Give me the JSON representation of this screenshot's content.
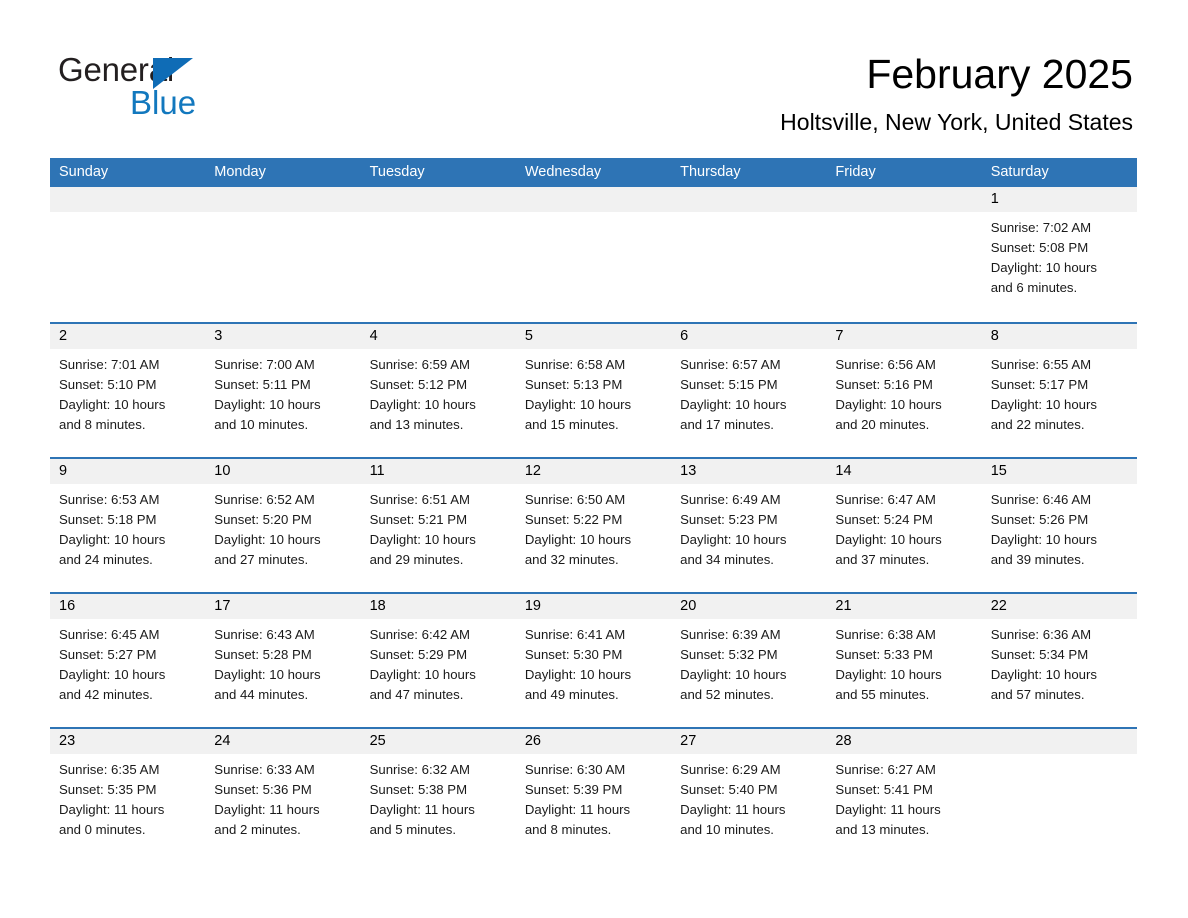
{
  "brand": {
    "name_part1": "General",
    "name_part2": "Blue"
  },
  "header": {
    "title": "February 2025",
    "subtitle": "Holtsville, New York, United States"
  },
  "colors": {
    "header_blue": "#2e74b5",
    "brand_blue": "#1278be",
    "daynum_strip": "#f1f1f1",
    "cell_background": "#ffffff"
  },
  "weekday_headers": [
    "Sunday",
    "Monday",
    "Tuesday",
    "Wednesday",
    "Thursday",
    "Friday",
    "Saturday"
  ],
  "weeks": [
    {
      "days": [
        {
          "day": "",
          "sunrise": "",
          "sunset": "",
          "daylight_line1": "",
          "daylight_line2": ""
        },
        {
          "day": "",
          "sunrise": "",
          "sunset": "",
          "daylight_line1": "",
          "daylight_line2": ""
        },
        {
          "day": "",
          "sunrise": "",
          "sunset": "",
          "daylight_line1": "",
          "daylight_line2": ""
        },
        {
          "day": "",
          "sunrise": "",
          "sunset": "",
          "daylight_line1": "",
          "daylight_line2": ""
        },
        {
          "day": "",
          "sunrise": "",
          "sunset": "",
          "daylight_line1": "",
          "daylight_line2": ""
        },
        {
          "day": "",
          "sunrise": "",
          "sunset": "",
          "daylight_line1": "",
          "daylight_line2": ""
        },
        {
          "day": "1",
          "sunrise": "Sunrise: 7:02 AM",
          "sunset": "Sunset: 5:08 PM",
          "daylight_line1": "Daylight: 10 hours",
          "daylight_line2": "and 6 minutes."
        }
      ]
    },
    {
      "days": [
        {
          "day": "2",
          "sunrise": "Sunrise: 7:01 AM",
          "sunset": "Sunset: 5:10 PM",
          "daylight_line1": "Daylight: 10 hours",
          "daylight_line2": "and 8 minutes."
        },
        {
          "day": "3",
          "sunrise": "Sunrise: 7:00 AM",
          "sunset": "Sunset: 5:11 PM",
          "daylight_line1": "Daylight: 10 hours",
          "daylight_line2": "and 10 minutes."
        },
        {
          "day": "4",
          "sunrise": "Sunrise: 6:59 AM",
          "sunset": "Sunset: 5:12 PM",
          "daylight_line1": "Daylight: 10 hours",
          "daylight_line2": "and 13 minutes."
        },
        {
          "day": "5",
          "sunrise": "Sunrise: 6:58 AM",
          "sunset": "Sunset: 5:13 PM",
          "daylight_line1": "Daylight: 10 hours",
          "daylight_line2": "and 15 minutes."
        },
        {
          "day": "6",
          "sunrise": "Sunrise: 6:57 AM",
          "sunset": "Sunset: 5:15 PM",
          "daylight_line1": "Daylight: 10 hours",
          "daylight_line2": "and 17 minutes."
        },
        {
          "day": "7",
          "sunrise": "Sunrise: 6:56 AM",
          "sunset": "Sunset: 5:16 PM",
          "daylight_line1": "Daylight: 10 hours",
          "daylight_line2": "and 20 minutes."
        },
        {
          "day": "8",
          "sunrise": "Sunrise: 6:55 AM",
          "sunset": "Sunset: 5:17 PM",
          "daylight_line1": "Daylight: 10 hours",
          "daylight_line2": "and 22 minutes."
        }
      ]
    },
    {
      "days": [
        {
          "day": "9",
          "sunrise": "Sunrise: 6:53 AM",
          "sunset": "Sunset: 5:18 PM",
          "daylight_line1": "Daylight: 10 hours",
          "daylight_line2": "and 24 minutes."
        },
        {
          "day": "10",
          "sunrise": "Sunrise: 6:52 AM",
          "sunset": "Sunset: 5:20 PM",
          "daylight_line1": "Daylight: 10 hours",
          "daylight_line2": "and 27 minutes."
        },
        {
          "day": "11",
          "sunrise": "Sunrise: 6:51 AM",
          "sunset": "Sunset: 5:21 PM",
          "daylight_line1": "Daylight: 10 hours",
          "daylight_line2": "and 29 minutes."
        },
        {
          "day": "12",
          "sunrise": "Sunrise: 6:50 AM",
          "sunset": "Sunset: 5:22 PM",
          "daylight_line1": "Daylight: 10 hours",
          "daylight_line2": "and 32 minutes."
        },
        {
          "day": "13",
          "sunrise": "Sunrise: 6:49 AM",
          "sunset": "Sunset: 5:23 PM",
          "daylight_line1": "Daylight: 10 hours",
          "daylight_line2": "and 34 minutes."
        },
        {
          "day": "14",
          "sunrise": "Sunrise: 6:47 AM",
          "sunset": "Sunset: 5:24 PM",
          "daylight_line1": "Daylight: 10 hours",
          "daylight_line2": "and 37 minutes."
        },
        {
          "day": "15",
          "sunrise": "Sunrise: 6:46 AM",
          "sunset": "Sunset: 5:26 PM",
          "daylight_line1": "Daylight: 10 hours",
          "daylight_line2": "and 39 minutes."
        }
      ]
    },
    {
      "days": [
        {
          "day": "16",
          "sunrise": "Sunrise: 6:45 AM",
          "sunset": "Sunset: 5:27 PM",
          "daylight_line1": "Daylight: 10 hours",
          "daylight_line2": "and 42 minutes."
        },
        {
          "day": "17",
          "sunrise": "Sunrise: 6:43 AM",
          "sunset": "Sunset: 5:28 PM",
          "daylight_line1": "Daylight: 10 hours",
          "daylight_line2": "and 44 minutes."
        },
        {
          "day": "18",
          "sunrise": "Sunrise: 6:42 AM",
          "sunset": "Sunset: 5:29 PM",
          "daylight_line1": "Daylight: 10 hours",
          "daylight_line2": "and 47 minutes."
        },
        {
          "day": "19",
          "sunrise": "Sunrise: 6:41 AM",
          "sunset": "Sunset: 5:30 PM",
          "daylight_line1": "Daylight: 10 hours",
          "daylight_line2": "and 49 minutes."
        },
        {
          "day": "20",
          "sunrise": "Sunrise: 6:39 AM",
          "sunset": "Sunset: 5:32 PM",
          "daylight_line1": "Daylight: 10 hours",
          "daylight_line2": "and 52 minutes."
        },
        {
          "day": "21",
          "sunrise": "Sunrise: 6:38 AM",
          "sunset": "Sunset: 5:33 PM",
          "daylight_line1": "Daylight: 10 hours",
          "daylight_line2": "and 55 minutes."
        },
        {
          "day": "22",
          "sunrise": "Sunrise: 6:36 AM",
          "sunset": "Sunset: 5:34 PM",
          "daylight_line1": "Daylight: 10 hours",
          "daylight_line2": "and 57 minutes."
        }
      ]
    },
    {
      "days": [
        {
          "day": "23",
          "sunrise": "Sunrise: 6:35 AM",
          "sunset": "Sunset: 5:35 PM",
          "daylight_line1": "Daylight: 11 hours",
          "daylight_line2": "and 0 minutes."
        },
        {
          "day": "24",
          "sunrise": "Sunrise: 6:33 AM",
          "sunset": "Sunset: 5:36 PM",
          "daylight_line1": "Daylight: 11 hours",
          "daylight_line2": "and 2 minutes."
        },
        {
          "day": "25",
          "sunrise": "Sunrise: 6:32 AM",
          "sunset": "Sunset: 5:38 PM",
          "daylight_line1": "Daylight: 11 hours",
          "daylight_line2": "and 5 minutes."
        },
        {
          "day": "26",
          "sunrise": "Sunrise: 6:30 AM",
          "sunset": "Sunset: 5:39 PM",
          "daylight_line1": "Daylight: 11 hours",
          "daylight_line2": "and 8 minutes."
        },
        {
          "day": "27",
          "sunrise": "Sunrise: 6:29 AM",
          "sunset": "Sunset: 5:40 PM",
          "daylight_line1": "Daylight: 11 hours",
          "daylight_line2": "and 10 minutes."
        },
        {
          "day": "28",
          "sunrise": "Sunrise: 6:27 AM",
          "sunset": "Sunset: 5:41 PM",
          "daylight_line1": "Daylight: 11 hours",
          "daylight_line2": "and 13 minutes."
        },
        {
          "day": "",
          "sunrise": "",
          "sunset": "",
          "daylight_line1": "",
          "daylight_line2": ""
        }
      ]
    }
  ]
}
